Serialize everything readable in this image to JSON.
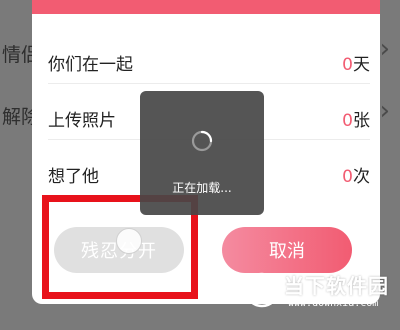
{
  "background": {
    "items": [
      {
        "label": "情侣"
      },
      {
        "label": "解除"
      }
    ]
  },
  "dialog": {
    "stats": [
      {
        "label": "你们在一起",
        "value": "0",
        "unit": "天"
      },
      {
        "label": "上传照片",
        "value": "0",
        "unit": "张"
      },
      {
        "label": "想了他",
        "value": "0",
        "unit": "次"
      }
    ],
    "break_button": "残忍分开",
    "cancel_button": "取消"
  },
  "loading": {
    "text": "正在加载..."
  },
  "watermark": {
    "title": "当下软件园",
    "url": "www.downxia.com"
  },
  "colors": {
    "accent": "#f25c72",
    "highlight": "#e8121b"
  }
}
